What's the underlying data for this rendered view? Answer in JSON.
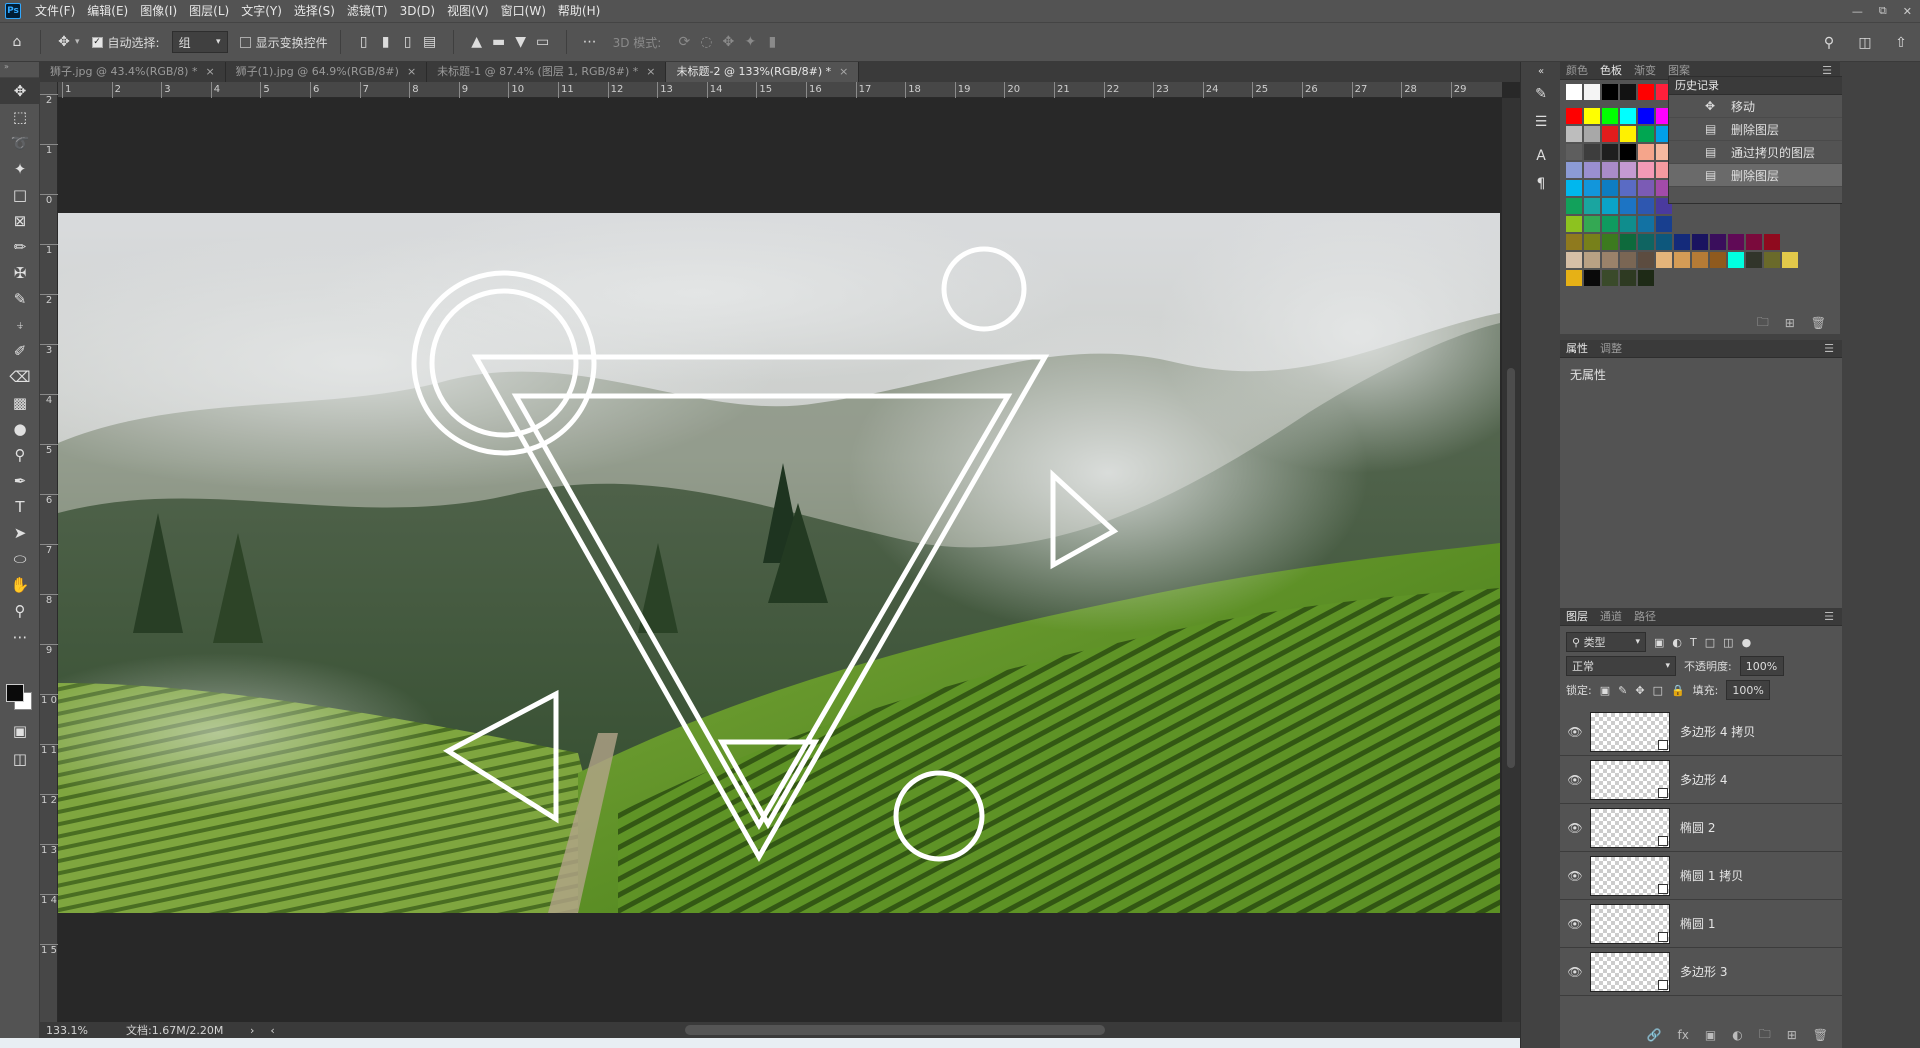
{
  "menubar": {
    "logo": "Ps",
    "items": [
      "文件(F)",
      "编辑(E)",
      "图像(I)",
      "图层(L)",
      "文字(Y)",
      "选择(S)",
      "滤镜(T)",
      "3D(D)",
      "视图(V)",
      "窗口(W)",
      "帮助(H)"
    ]
  },
  "options": {
    "auto_select_label": "自动选择:",
    "auto_select_value": "组",
    "show_transform_label": "显示变换控件",
    "mode3d_label": "3D 模式:"
  },
  "tabs": [
    {
      "label": "狮子.jpg @ 43.4%(RGB/8) *",
      "active": false
    },
    {
      "label": "狮子(1).jpg @ 64.9%(RGB/8#)",
      "active": false
    },
    {
      "label": "未标题-1 @ 87.4% (图层 1, RGB/8#) *",
      "active": false
    },
    {
      "label": "未标题-2 @ 133%(RGB/8#) *",
      "active": true
    }
  ],
  "rulers": {
    "h": [
      "1",
      "2",
      "3",
      "4",
      "5",
      "6",
      "7",
      "8",
      "9",
      "10",
      "11",
      "12",
      "13",
      "14",
      "15",
      "16",
      "17",
      "18",
      "19",
      "20",
      "21",
      "22",
      "23",
      "24",
      "25",
      "26",
      "27",
      "28",
      "29"
    ],
    "v": [
      "2",
      "1",
      "0",
      "1",
      "2",
      "3",
      "4",
      "5",
      "6",
      "7",
      "8",
      "9",
      "1 0",
      "1 1",
      "1 2",
      "1 3",
      "1 4",
      "1 5"
    ]
  },
  "status": {
    "zoom": "133.1%",
    "doc": "文档:1.67M/2.20M"
  },
  "swatches": {
    "tabs": [
      "颜色",
      "色板",
      "渐变",
      "图案"
    ],
    "active_tab": "色板",
    "colors": [
      [
        "#ffffff",
        "#f4f4f4",
        "#000000",
        "#121212",
        "#ff0000",
        "#ff1f3b"
      ],
      [
        "#ff0000",
        "#ffff00",
        "#00ff00",
        "#00ffff",
        "#0000ff",
        "#ff00ff"
      ],
      [
        "#bdbdbd",
        "#a8a8a8",
        "#e21c1c",
        "#fff100",
        "#00a651",
        "#00a0e9"
      ],
      [
        "#5e5e5e",
        "#3d3d3d",
        "#1f1f1f",
        "#000000",
        "#f5a58b",
        "#f6b9a0"
      ],
      [
        "#8c9bd5",
        "#9a8fd0",
        "#a98cc9",
        "#c49ad1",
        "#f39ab6",
        "#f59aa0"
      ],
      [
        "#00b7ee",
        "#1296db",
        "#0e7dc2",
        "#5a6bc4",
        "#7b5bb5",
        "#a24ba9"
      ],
      [
        "#12a15b",
        "#1aa5a0",
        "#0aa3c8",
        "#1c74c4",
        "#2e57b0",
        "#4a3a9e"
      ],
      [
        "#8dc21f",
        "#34a853",
        "#0f9b5f",
        "#0f8d8d",
        "#1272a3",
        "#183f8f"
      ],
      [
        "#8f7a1e",
        "#77801a",
        "#3c7a1f",
        "#0e6a3c",
        "#0f6461",
        "#0d577c",
        "#142a7a",
        "#1a1460",
        "#3a0e5c",
        "#600a56",
        "#7a0a3c",
        "#8f0a1e"
      ],
      [
        "#d6bfa6",
        "#b9a184",
        "#9a826a",
        "#7a6654",
        "#5c4c40",
        "#e4b47a",
        "#d49c56",
        "#b57b36",
        "#8f5a1e",
        "#00ffe0",
        "#31352a",
        "#6a6a2a",
        "#e2c84a"
      ],
      [
        "#e6b116",
        "#0a0a0a",
        "#3a4a2a",
        "#2e3a22",
        "#1e2a16"
      ]
    ]
  },
  "history": {
    "title": "历史记录",
    "items": [
      {
        "label": "移动",
        "icon": "move-icon"
      },
      {
        "label": "删除图层",
        "icon": "doc-icon"
      },
      {
        "label": "通过拷贝的图层",
        "icon": "doc-icon"
      },
      {
        "label": "删除图层",
        "icon": "doc-icon"
      }
    ]
  },
  "properties": {
    "tabs": [
      "属性",
      "调整"
    ],
    "empty_text": "无属性"
  },
  "layers": {
    "tabs": [
      "图层",
      "通道",
      "路径"
    ],
    "filter_label": "类型",
    "blend_mode": "正常",
    "opacity_label": "不透明度:",
    "opacity_value": "100%",
    "lock_label": "锁定:",
    "fill_label": "填充:",
    "fill_value": "100%",
    "items": [
      {
        "name": "多边形 4 拷贝"
      },
      {
        "name": "多边形 4"
      },
      {
        "name": "椭圆 2"
      },
      {
        "name": "椭圆 1 拷贝"
      },
      {
        "name": "椭圆 1"
      },
      {
        "name": "多边形 3"
      }
    ]
  }
}
